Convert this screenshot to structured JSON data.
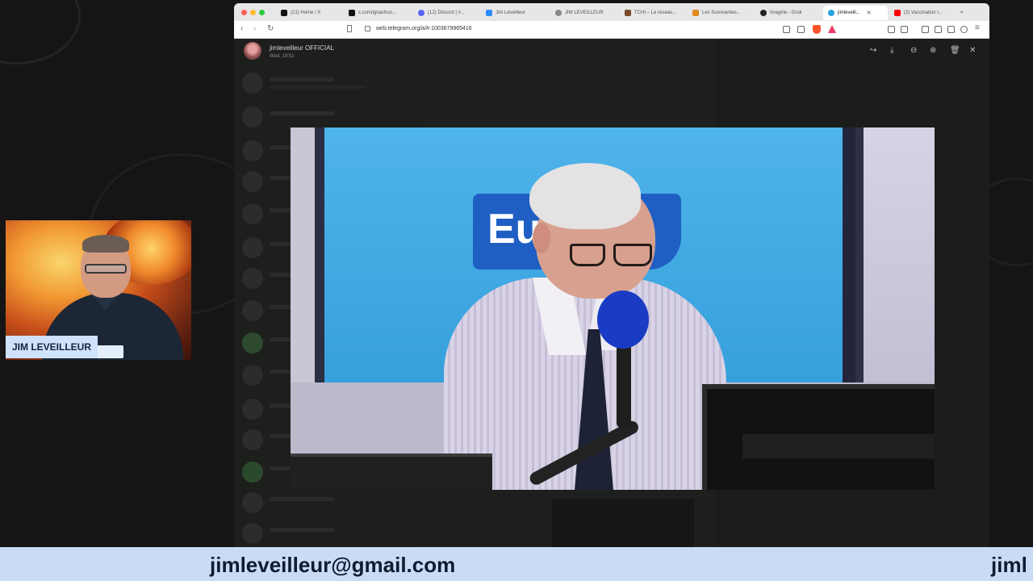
{
  "browser": {
    "tabs": [
      {
        "label": "(21) Home / X",
        "favicon": "x-icon",
        "color": "#111111"
      },
      {
        "label": "x.com/ignachuo...",
        "favicon": "x-icon",
        "color": "#111111"
      },
      {
        "label": "(12) Discord | #...",
        "favicon": "discord-icon",
        "color": "#5865f2"
      },
      {
        "label": "Jim Leveilleur",
        "favicon": "zoom-icon",
        "color": "#2d8cff"
      },
      {
        "label": "JIM LEVEILLEUR",
        "favicon": "user-icon",
        "color": "#888888"
      },
      {
        "label": "TCHI – Le réseau...",
        "favicon": "tchi-icon",
        "color": "#7a4a2a"
      },
      {
        "label": "Les Survivantes...",
        "favicon": "survivantes-icon",
        "color": "#e08a1e"
      },
      {
        "label": "Imagine - Grok",
        "favicon": "grok-icon",
        "color": "#222222"
      },
      {
        "label": "jimleveill...",
        "favicon": "telegram-icon",
        "color": "#2aa3df"
      },
      {
        "label": "(2) Vaccination I...",
        "favicon": "youtube-icon",
        "color": "#ff0000"
      }
    ],
    "url": "web.telegram.org/a/#-1003679965416"
  },
  "viewer": {
    "sender": "jimleveilleur OFFICIAL",
    "time": "Wed, 19:51",
    "actions": [
      "forward-icon",
      "download-icon",
      "zoom-out-icon",
      "zoom-in-icon",
      "delete-icon",
      "close-icon"
    ]
  },
  "video": {
    "logo_text": "Eu"
  },
  "webcam": {
    "name": "JIM LEVEILLEUR"
  },
  "ticker": {
    "text": "jimleveilleur@gmail.com",
    "text_repeat": "jiml"
  }
}
